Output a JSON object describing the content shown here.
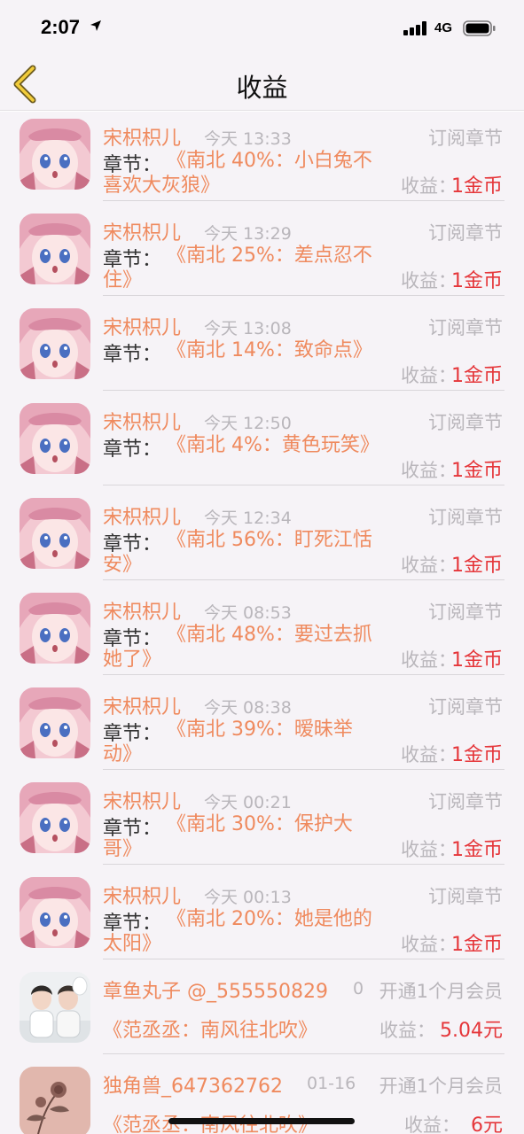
{
  "status": {
    "time": "2:07",
    "network": "4G"
  },
  "nav": {
    "title": "收益"
  },
  "subscriptions": [
    {
      "name": "宋枳枳儿",
      "time": "今天 13:33",
      "type": "订阅章节",
      "chapter_label": "章节：",
      "chapter": "《南北 40%：小白兔不喜欢大灰狼》",
      "earn_label": "收益：",
      "earn": "1金币"
    },
    {
      "name": "宋枳枳儿",
      "time": "今天 13:29",
      "type": "订阅章节",
      "chapter_label": "章节：",
      "chapter": "《南北 25%：差点忍不住》",
      "earn_label": "收益：",
      "earn": "1金币"
    },
    {
      "name": "宋枳枳儿",
      "time": "今天 13:08",
      "type": "订阅章节",
      "chapter_label": "章节：",
      "chapter": "《南北 14%：致命点》",
      "earn_label": "收益：",
      "earn": "1金币"
    },
    {
      "name": "宋枳枳儿",
      "time": "今天 12:50",
      "type": "订阅章节",
      "chapter_label": "章节：",
      "chapter": "《南北 4%：黄色玩笑》",
      "earn_label": "收益：",
      "earn": "1金币"
    },
    {
      "name": "宋枳枳儿",
      "time": "今天 12:34",
      "type": "订阅章节",
      "chapter_label": "章节：",
      "chapter": "《南北 56%：盯死江恬安》",
      "earn_label": "收益：",
      "earn": "1金币"
    },
    {
      "name": "宋枳枳儿",
      "time": "今天 08:53",
      "type": "订阅章节",
      "chapter_label": "章节：",
      "chapter": "《南北 48%：要过去抓她了》",
      "earn_label": "收益：",
      "earn": "1金币"
    },
    {
      "name": "宋枳枳儿",
      "time": "今天 08:38",
      "type": "订阅章节",
      "chapter_label": "章节：",
      "chapter": "《南北 39%：暧昧举动》",
      "earn_label": "收益：",
      "earn": "1金币"
    },
    {
      "name": "宋枳枳儿",
      "time": "今天 00:21",
      "type": "订阅章节",
      "chapter_label": "章节：",
      "chapter": "《南北 30%：保护大哥》",
      "earn_label": "收益：",
      "earn": "1金币"
    },
    {
      "name": "宋枳枳儿",
      "time": "今天 00:13",
      "type": "订阅章节",
      "chapter_label": "章节：",
      "chapter": "《南北 20%：她是他的太阳》",
      "earn_label": "收益：",
      "earn": "1金币"
    }
  ],
  "members": [
    {
      "name": "章鱼丸子 @_555550829",
      "time": "0",
      "type": "开通1个月会员",
      "book": "《范丞丞：南风往北吹》",
      "earn_label": "收益：",
      "earn": "5.04元"
    },
    {
      "name": "独角兽_647362762",
      "time": "01-16",
      "type": "开通1个月会员",
      "book": "《范丞丞：南风往北吹》",
      "earn_label": "收益：",
      "earn": "6元"
    }
  ]
}
